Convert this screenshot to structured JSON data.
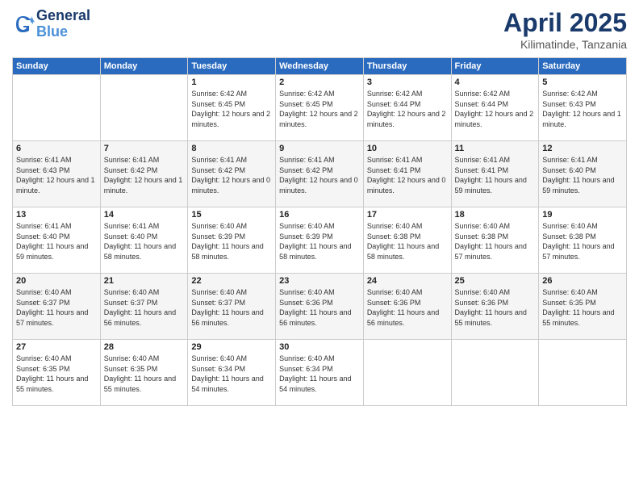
{
  "header": {
    "logo_line1": "General",
    "logo_line2": "Blue",
    "month_title": "April 2025",
    "subtitle": "Kilimatinde, Tanzania"
  },
  "weekdays": [
    "Sunday",
    "Monday",
    "Tuesday",
    "Wednesday",
    "Thursday",
    "Friday",
    "Saturday"
  ],
  "weeks": [
    [
      {
        "day": "",
        "info": ""
      },
      {
        "day": "",
        "info": ""
      },
      {
        "day": "1",
        "info": "Sunrise: 6:42 AM\nSunset: 6:45 PM\nDaylight: 12 hours and 2 minutes."
      },
      {
        "day": "2",
        "info": "Sunrise: 6:42 AM\nSunset: 6:45 PM\nDaylight: 12 hours and 2 minutes."
      },
      {
        "day": "3",
        "info": "Sunrise: 6:42 AM\nSunset: 6:44 PM\nDaylight: 12 hours and 2 minutes."
      },
      {
        "day": "4",
        "info": "Sunrise: 6:42 AM\nSunset: 6:44 PM\nDaylight: 12 hours and 2 minutes."
      },
      {
        "day": "5",
        "info": "Sunrise: 6:42 AM\nSunset: 6:43 PM\nDaylight: 12 hours and 1 minute."
      }
    ],
    [
      {
        "day": "6",
        "info": "Sunrise: 6:41 AM\nSunset: 6:43 PM\nDaylight: 12 hours and 1 minute."
      },
      {
        "day": "7",
        "info": "Sunrise: 6:41 AM\nSunset: 6:42 PM\nDaylight: 12 hours and 1 minute."
      },
      {
        "day": "8",
        "info": "Sunrise: 6:41 AM\nSunset: 6:42 PM\nDaylight: 12 hours and 0 minutes."
      },
      {
        "day": "9",
        "info": "Sunrise: 6:41 AM\nSunset: 6:42 PM\nDaylight: 12 hours and 0 minutes."
      },
      {
        "day": "10",
        "info": "Sunrise: 6:41 AM\nSunset: 6:41 PM\nDaylight: 12 hours and 0 minutes."
      },
      {
        "day": "11",
        "info": "Sunrise: 6:41 AM\nSunset: 6:41 PM\nDaylight: 11 hours and 59 minutes."
      },
      {
        "day": "12",
        "info": "Sunrise: 6:41 AM\nSunset: 6:40 PM\nDaylight: 11 hours and 59 minutes."
      }
    ],
    [
      {
        "day": "13",
        "info": "Sunrise: 6:41 AM\nSunset: 6:40 PM\nDaylight: 11 hours and 59 minutes."
      },
      {
        "day": "14",
        "info": "Sunrise: 6:41 AM\nSunset: 6:40 PM\nDaylight: 11 hours and 58 minutes."
      },
      {
        "day": "15",
        "info": "Sunrise: 6:40 AM\nSunset: 6:39 PM\nDaylight: 11 hours and 58 minutes."
      },
      {
        "day": "16",
        "info": "Sunrise: 6:40 AM\nSunset: 6:39 PM\nDaylight: 11 hours and 58 minutes."
      },
      {
        "day": "17",
        "info": "Sunrise: 6:40 AM\nSunset: 6:38 PM\nDaylight: 11 hours and 58 minutes."
      },
      {
        "day": "18",
        "info": "Sunrise: 6:40 AM\nSunset: 6:38 PM\nDaylight: 11 hours and 57 minutes."
      },
      {
        "day": "19",
        "info": "Sunrise: 6:40 AM\nSunset: 6:38 PM\nDaylight: 11 hours and 57 minutes."
      }
    ],
    [
      {
        "day": "20",
        "info": "Sunrise: 6:40 AM\nSunset: 6:37 PM\nDaylight: 11 hours and 57 minutes."
      },
      {
        "day": "21",
        "info": "Sunrise: 6:40 AM\nSunset: 6:37 PM\nDaylight: 11 hours and 56 minutes."
      },
      {
        "day": "22",
        "info": "Sunrise: 6:40 AM\nSunset: 6:37 PM\nDaylight: 11 hours and 56 minutes."
      },
      {
        "day": "23",
        "info": "Sunrise: 6:40 AM\nSunset: 6:36 PM\nDaylight: 11 hours and 56 minutes."
      },
      {
        "day": "24",
        "info": "Sunrise: 6:40 AM\nSunset: 6:36 PM\nDaylight: 11 hours and 56 minutes."
      },
      {
        "day": "25",
        "info": "Sunrise: 6:40 AM\nSunset: 6:36 PM\nDaylight: 11 hours and 55 minutes."
      },
      {
        "day": "26",
        "info": "Sunrise: 6:40 AM\nSunset: 6:35 PM\nDaylight: 11 hours and 55 minutes."
      }
    ],
    [
      {
        "day": "27",
        "info": "Sunrise: 6:40 AM\nSunset: 6:35 PM\nDaylight: 11 hours and 55 minutes."
      },
      {
        "day": "28",
        "info": "Sunrise: 6:40 AM\nSunset: 6:35 PM\nDaylight: 11 hours and 55 minutes."
      },
      {
        "day": "29",
        "info": "Sunrise: 6:40 AM\nSunset: 6:34 PM\nDaylight: 11 hours and 54 minutes."
      },
      {
        "day": "30",
        "info": "Sunrise: 6:40 AM\nSunset: 6:34 PM\nDaylight: 11 hours and 54 minutes."
      },
      {
        "day": "",
        "info": ""
      },
      {
        "day": "",
        "info": ""
      },
      {
        "day": "",
        "info": ""
      }
    ]
  ]
}
